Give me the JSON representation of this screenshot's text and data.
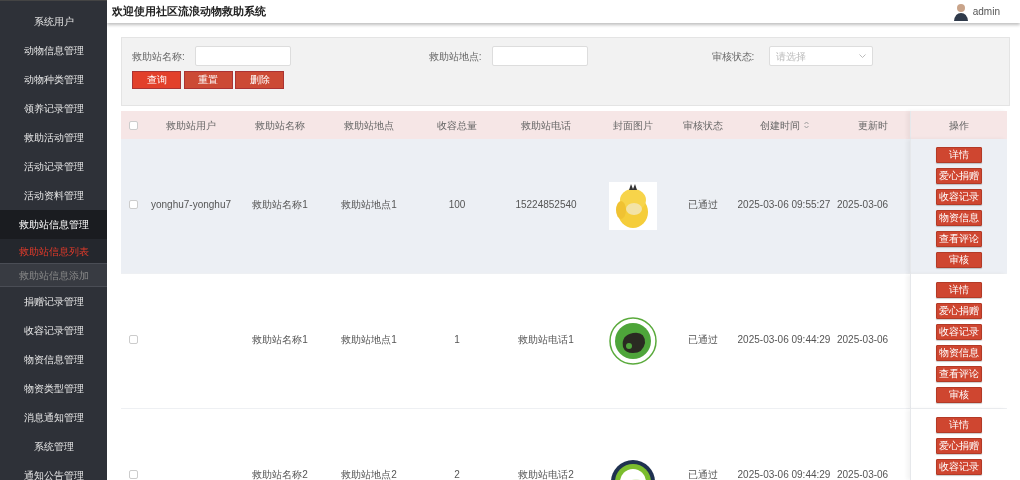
{
  "header": {
    "title": "欢迎使用社区流浪动物救助系统",
    "user": "admin"
  },
  "sidebar": {
    "items": [
      {
        "label": "系统用户"
      },
      {
        "label": "动物信息管理"
      },
      {
        "label": "动物种类管理"
      },
      {
        "label": "领养记录管理"
      },
      {
        "label": "救助活动管理"
      },
      {
        "label": "活动记录管理"
      },
      {
        "label": "活动资料管理"
      },
      {
        "label": "救助站信息管理",
        "expanded": true,
        "children": [
          {
            "label": "救助站信息列表",
            "selected": true
          },
          {
            "label": "救助站信息添加",
            "selected": false
          }
        ]
      },
      {
        "label": "捐赠记录管理"
      },
      {
        "label": "收容记录管理"
      },
      {
        "label": "物资信息管理"
      },
      {
        "label": "物资类型管理"
      },
      {
        "label": "消息通知管理"
      },
      {
        "label": "系统管理"
      },
      {
        "label": "通知公告管理"
      }
    ]
  },
  "search": {
    "fields": [
      {
        "kind": "input",
        "label": "救助站名称:"
      },
      {
        "kind": "input",
        "label": "救助站地点:"
      },
      {
        "kind": "select",
        "label": "审核状态:",
        "placeholder": "请选择"
      }
    ],
    "buttons": [
      {
        "label": "查询",
        "kind": "primary"
      },
      {
        "label": "重置",
        "kind": "secondary"
      },
      {
        "label": "删除",
        "kind": "secondary"
      }
    ]
  },
  "table": {
    "header_checked": false,
    "columns": [
      {
        "label": "救助站用户"
      },
      {
        "label": "救助站名称"
      },
      {
        "label": "救助站地点"
      },
      {
        "label": "收容总量"
      },
      {
        "label": "救助站电话"
      },
      {
        "label": "封面图片"
      },
      {
        "label": "审核状态"
      },
      {
        "label": "创建时间",
        "sortable": true
      },
      {
        "label": "更新时"
      },
      {
        "label": "操作"
      }
    ],
    "rows": [
      {
        "checked": false,
        "hovered": true,
        "cells": [
          "yonghu7-yonghu7",
          "救助站名称1",
          "救助站地点1",
          "100",
          "15224852540"
        ],
        "cover": {
          "kind": "picture"
        },
        "status": "已通过",
        "created": "2025-03-06 09:55:27",
        "updated": "2025-03-06",
        "actions": [
          "详情",
          "爱心捐赠",
          "收容记录",
          "物资信息",
          "查看评论",
          "审核"
        ]
      },
      {
        "checked": false,
        "hovered": false,
        "cells": [
          "",
          "救助站名称1",
          "救助站地点1",
          "1",
          "救助站电话1"
        ],
        "cover": {
          "kind": "picture"
        },
        "status": "已通过",
        "created": "2025-03-06 09:44:29",
        "updated": "2025-03-06",
        "actions": [
          "详情",
          "爱心捐赠",
          "收容记录",
          "物资信息",
          "查看评论",
          "审核"
        ]
      },
      {
        "checked": false,
        "hovered": false,
        "cells": [
          "",
          "救助站名称2",
          "救助站地点2",
          "2",
          "救助站电话2"
        ],
        "cover": {
          "kind": "picture"
        },
        "status": "已通过",
        "created": "2025-03-06 09:44:29",
        "updated": "2025-03-06",
        "actions": [
          "详情",
          "爱心捐赠",
          "收容记录"
        ]
      }
    ]
  }
}
